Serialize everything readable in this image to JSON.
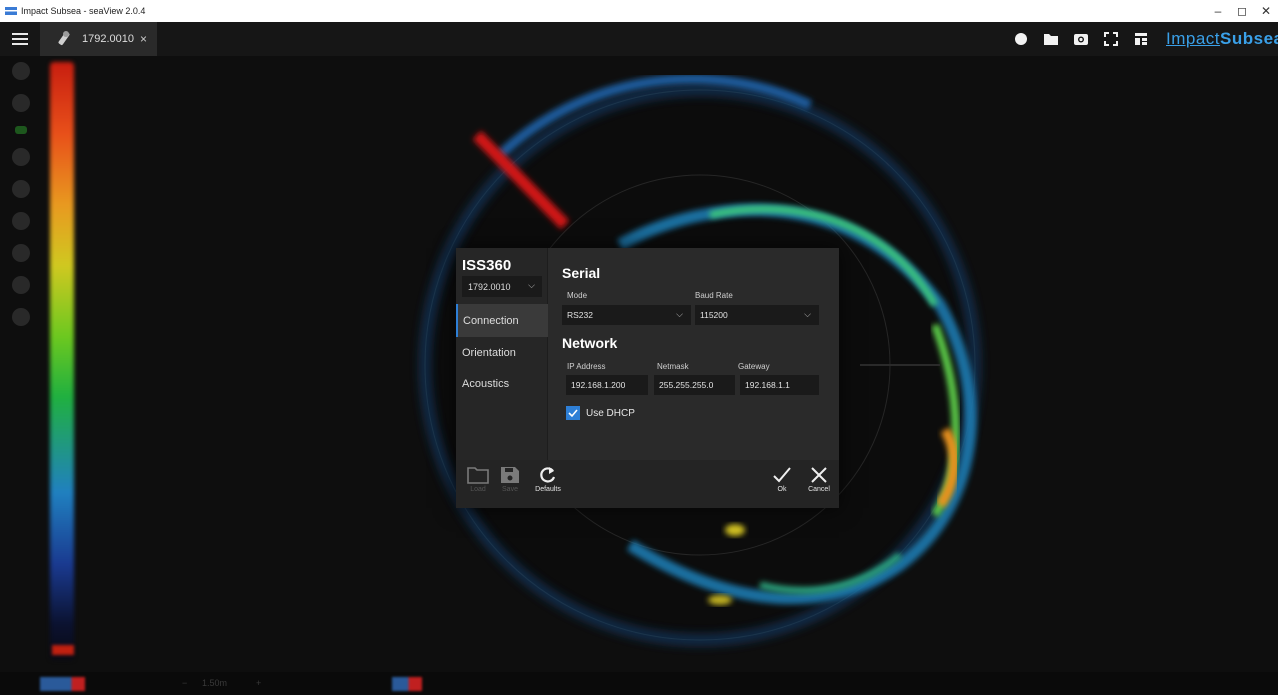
{
  "window": {
    "title": "Impact Subsea - seaView 2.0.4",
    "controls": [
      "–",
      "◻",
      "✕"
    ]
  },
  "header": {
    "tab_label": "1792.0010",
    "tab_close": "×",
    "logo_bold": "Impact",
    "logo_rest": "Subsea"
  },
  "dialog": {
    "title": "ISS360",
    "serial_select": "1792.0010",
    "nav": [
      {
        "label": "Connection",
        "active": true
      },
      {
        "label": "Orientation",
        "active": false
      },
      {
        "label": "Acoustics",
        "active": false
      }
    ],
    "serial": {
      "title": "Serial",
      "mode_label": "Mode",
      "mode_value": "RS232",
      "baud_label": "Baud Rate",
      "baud_value": "115200"
    },
    "network": {
      "title": "Network",
      "ip_label": "IP Address",
      "ip_value": "192.168.1.200",
      "netmask_label": "Netmask",
      "netmask_value": "255.255.255.0",
      "gateway_label": "Gateway",
      "gateway_value": "192.168.1.1",
      "dhcp_label": "Use DHCP",
      "dhcp_checked": true
    },
    "footer": {
      "load": "Load",
      "save": "Save",
      "defaults": "Defaults",
      "ok": "Ok",
      "cancel": "Cancel"
    }
  },
  "bottom_bar": {
    "range": "1.50m",
    "minus": "−",
    "plus": "+"
  },
  "colors": {
    "accent": "#2e7fd6",
    "dialog_bg": "#2a2a2a",
    "field_bg": "#1a1a1a",
    "logo": "#3aa0e8"
  }
}
